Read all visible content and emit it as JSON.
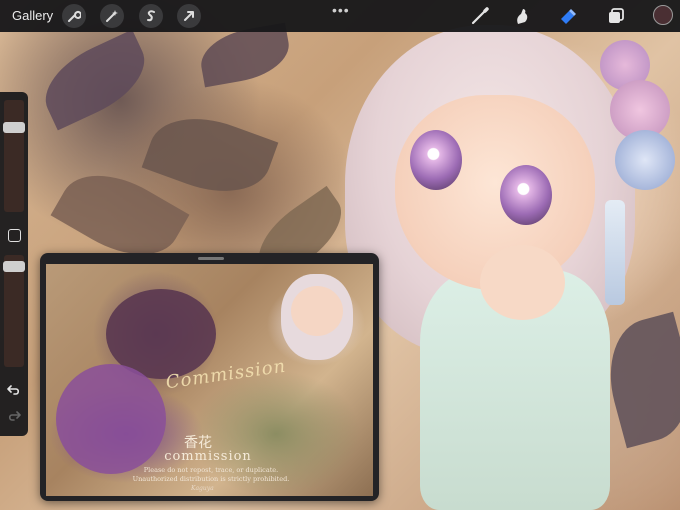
{
  "toolbar": {
    "gallery_label": "Gallery",
    "more_label": "•••",
    "left_tools": [
      "wrench-icon",
      "magic-wand-icon",
      "selection-icon",
      "transform-arrow-icon"
    ],
    "right_tools": [
      "brush-icon",
      "smudge-icon",
      "eraser-icon",
      "layers-icon"
    ],
    "active_tool": "eraser-icon",
    "active_color": "#4a2f33",
    "accent_color": "#2f7cf6"
  },
  "sidebar": {
    "size_slider_level": 0.05,
    "opacity_slider_level": 0.05,
    "buttons": [
      "modify-square-button",
      "undo-button",
      "redo-button"
    ]
  },
  "reference": {
    "script_title": "Commission",
    "kanji": "香花",
    "commission_text": "commission",
    "notice_line_1": "Please do not repost, trace, or duplicate.",
    "notice_line_2": "Unauthorized distribution is strictly prohibited.",
    "signature": "Kaguya"
  }
}
